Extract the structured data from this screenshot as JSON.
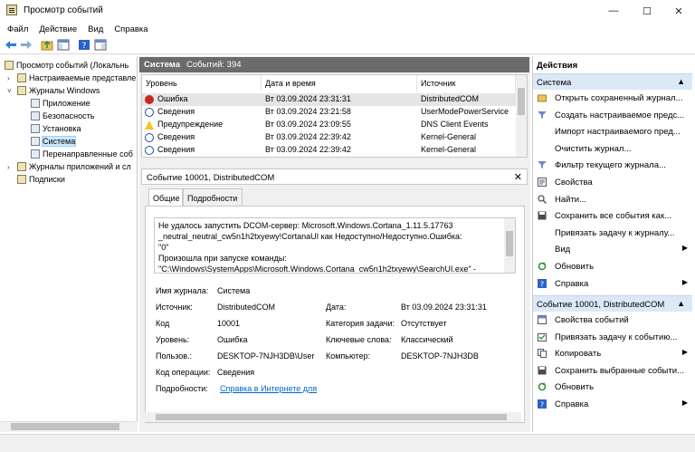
{
  "window": {
    "title": "Просмотр событий",
    "minimize": "—",
    "maximize": "☐",
    "close": "✕"
  },
  "menu": [
    "Файл",
    "Действие",
    "Вид",
    "Справка"
  ],
  "tree": {
    "root": "Просмотр событий (Локальнь",
    "custom_views": "Настраиваемые представле",
    "windows_logs": "Журналы Windows",
    "application": "Приложение",
    "security": "Безопасность",
    "setup": "Установка",
    "system": "Система",
    "forwarded": "Перенаправленные соб",
    "apps_services": "Журналы приложений и сл",
    "subscriptions": "Подписки"
  },
  "log_header": {
    "title": "Система",
    "count": "Событий: 394"
  },
  "event_list": {
    "columns": [
      "Уровень",
      "Дата и время",
      "Источник"
    ],
    "rows": [
      {
        "level": "Ошибка",
        "type": "error",
        "datetime": "Вт 03.09.2024 23:31:31",
        "source": "DistributedCOM"
      },
      {
        "level": "Сведения",
        "type": "info",
        "datetime": "Вт 03.09.2024 23:21:58",
        "source": "UserModePowerService"
      },
      {
        "level": "Предупреждение",
        "type": "warning",
        "datetime": "Вт 03.09.2024 23:09:55",
        "source": "DNS Client Events"
      },
      {
        "level": "Сведения",
        "type": "info",
        "datetime": "Вт 03.09.2024 22:39:42",
        "source": "Kernel-General"
      },
      {
        "level": "Сведения",
        "type": "info",
        "datetime": "Вт 03.09.2024 22:39:42",
        "source": "Kernel-General"
      }
    ]
  },
  "event_detail": {
    "title": "Событие 10001, DistributedCOM",
    "close": "✕",
    "tabs": [
      "Общие",
      "Подробности"
    ],
    "description": [
      "Не удалось запустить DCOM-сервер: Microsoft.Windows.Cortana_1.11.5.17763",
      "_neutral_neutral_cw5n1h2txyewy!CortanaUI как Недоступно/Недоступно.Ошибка:",
      "\"0\"",
      "Произошла при запуске команды:",
      "\"C:\\Windows\\SystemApps\\Microsoft.Windows.Cortana_cw5n1h2txyewy\\SearchUI.exe\" -"
    ],
    "fields": {
      "log_name_label": "Имя журнала:",
      "log_name": "Система",
      "source_label": "Источник:",
      "source": "DistributedCOM",
      "date_label": "Дата:",
      "date": "Вт 03.09.2024 23:31:31",
      "code_label": "Код",
      "code": "10001",
      "task_category_label": "Категория задачи:",
      "task_category": "Отсутствует",
      "level_label": "Уровень:",
      "level": "Ошибка",
      "keywords_label": "Ключевые слова:",
      "keywords": "Классический",
      "user_label": "Пользов.:",
      "user": "DESKTOP-7NJH3DB\\User",
      "computer_label": "Компьютер:",
      "computer": "DESKTOP-7NJH3DB",
      "opcode_label": "Код операции:",
      "opcode": "Сведения",
      "more_info_label": "Подробности:",
      "more_info_link": "Справка в Интернете для"
    }
  },
  "actions": {
    "header": "Действия",
    "section1": "Система",
    "section1_items": [
      {
        "label": "Открыть сохраненный журнал...",
        "icon": "folder-open-icon",
        "submenu": false
      },
      {
        "label": "Создать настраиваемое предс...",
        "icon": "filter-create-icon",
        "submenu": false
      },
      {
        "label": "Импорт настраиваемого пред...",
        "icon": "",
        "submenu": false
      },
      {
        "label": "Очистить журнал...",
        "icon": "",
        "submenu": false
      },
      {
        "label": "Фильтр текущего журнала...",
        "icon": "filter-icon",
        "submenu": false
      },
      {
        "label": "Свойства",
        "icon": "properties-icon",
        "submenu": false
      },
      {
        "label": "Найти...",
        "icon": "find-icon",
        "submenu": false
      },
      {
        "label": "Сохранить все события как...",
        "icon": "save-icon",
        "submenu": false
      },
      {
        "label": "Привязать задачу к журналу...",
        "icon": "",
        "submenu": false
      },
      {
        "label": "Вид",
        "icon": "",
        "submenu": true
      },
      {
        "label": "Обновить",
        "icon": "refresh-icon",
        "submenu": false
      },
      {
        "label": "Справка",
        "icon": "help-icon",
        "submenu": true
      }
    ],
    "section2": "Событие 10001, DistributedCOM",
    "section2_items": [
      {
        "label": "Свойства событий",
        "icon": "event-properties-icon",
        "submenu": false
      },
      {
        "label": "Привязать задачу к событию...",
        "icon": "task-icon",
        "submenu": false
      },
      {
        "label": "Копировать",
        "icon": "copy-icon",
        "submenu": true
      },
      {
        "label": "Сохранить выбранные событи...",
        "icon": "save-icon",
        "submenu": false
      },
      {
        "label": "Обновить",
        "icon": "refresh-icon",
        "submenu": false
      },
      {
        "label": "Справка",
        "icon": "help-icon",
        "submenu": true
      }
    ]
  },
  "colors": {
    "header_gray": "#6b6b6b",
    "section_blue": "#dbe8f6",
    "selection": "#cce8ff",
    "error_red": "#c42b1c",
    "warning_yellow": "#f3c623",
    "link_blue": "#0066cc"
  }
}
